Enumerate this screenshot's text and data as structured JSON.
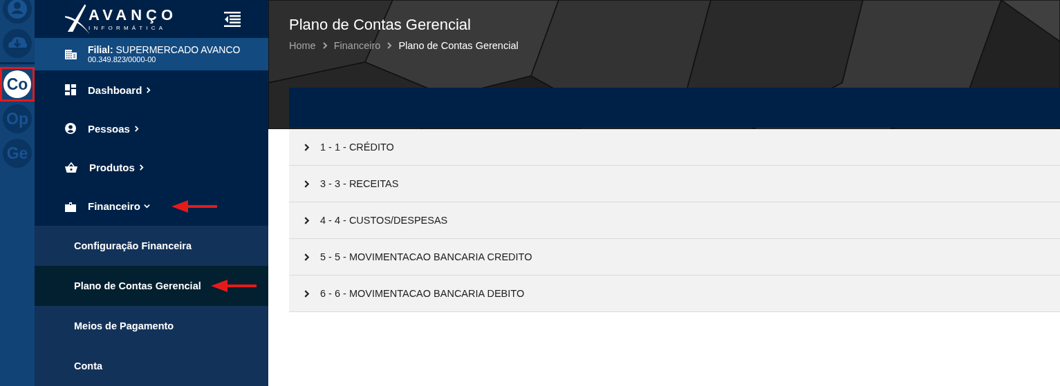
{
  "rail": {
    "apps": [
      {
        "label": "Co",
        "selected": true,
        "highlighted": true
      },
      {
        "label": "Op",
        "selected": false,
        "highlighted": false
      },
      {
        "label": "Ge",
        "selected": false,
        "highlighted": false
      }
    ]
  },
  "brand": {
    "name": "AVANÇO",
    "tagline": "INFORMÁTICA"
  },
  "branch": {
    "label": "Filial:",
    "name": "SUPERMERCADO AVANCO",
    "document": "00.349.823/0000-00"
  },
  "menu": [
    {
      "label": "Dashboard",
      "expanded": false,
      "marked": false
    },
    {
      "label": "Pessoas",
      "expanded": false,
      "marked": false
    },
    {
      "label": "Produtos",
      "expanded": false,
      "marked": false
    },
    {
      "label": "Financeiro",
      "expanded": true,
      "marked": true,
      "children": [
        {
          "label": "Configuração Financeira",
          "selected": false,
          "marked": false
        },
        {
          "label": "Plano de Contas Gerencial",
          "selected": true,
          "marked": true
        },
        {
          "label": "Meios de Pagamento",
          "selected": false,
          "marked": false
        },
        {
          "label": "Conta",
          "selected": false,
          "marked": false
        }
      ]
    }
  ],
  "page": {
    "title": "Plano de Contas Gerencial",
    "breadcrumb": [
      {
        "label": "Home",
        "current": false
      },
      {
        "label": "Financeiro",
        "current": false
      },
      {
        "label": "Plano de Contas Gerencial",
        "current": true
      }
    ]
  },
  "accounts": [
    {
      "label": "1 - 1 - CRÉDITO",
      "expanded": false
    },
    {
      "label": "3 - 3 - RECEITAS",
      "expanded": false
    },
    {
      "label": "4 - 4 - CUSTOS/DESPESAS",
      "expanded": false
    },
    {
      "label": "5 - 5 - MOVIMENTACAO BANCARIA CREDITO",
      "expanded": false
    },
    {
      "label": "6 - 6 - MOVIMENTACAO BANCARIA DEBITO",
      "expanded": false
    }
  ]
}
